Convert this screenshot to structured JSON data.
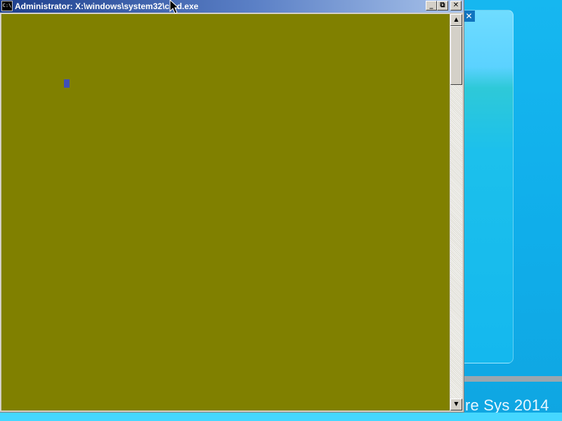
{
  "window": {
    "title": "Administrator: X:\\windows\\system32\\cmd.exe",
    "icon_label": "C:\\",
    "minimize_glyph": "_",
    "maximize_glyph": "⧉",
    "close_glyph": "✕"
  },
  "console": {
    "background_color": "#808000",
    "cursor_color": "#3f4fb8"
  },
  "scrollbar": {
    "up_glyph": "▲",
    "down_glyph": "▼"
  },
  "background": {
    "close_glyph": "✕",
    "footer_text": "re Sys 2014"
  }
}
